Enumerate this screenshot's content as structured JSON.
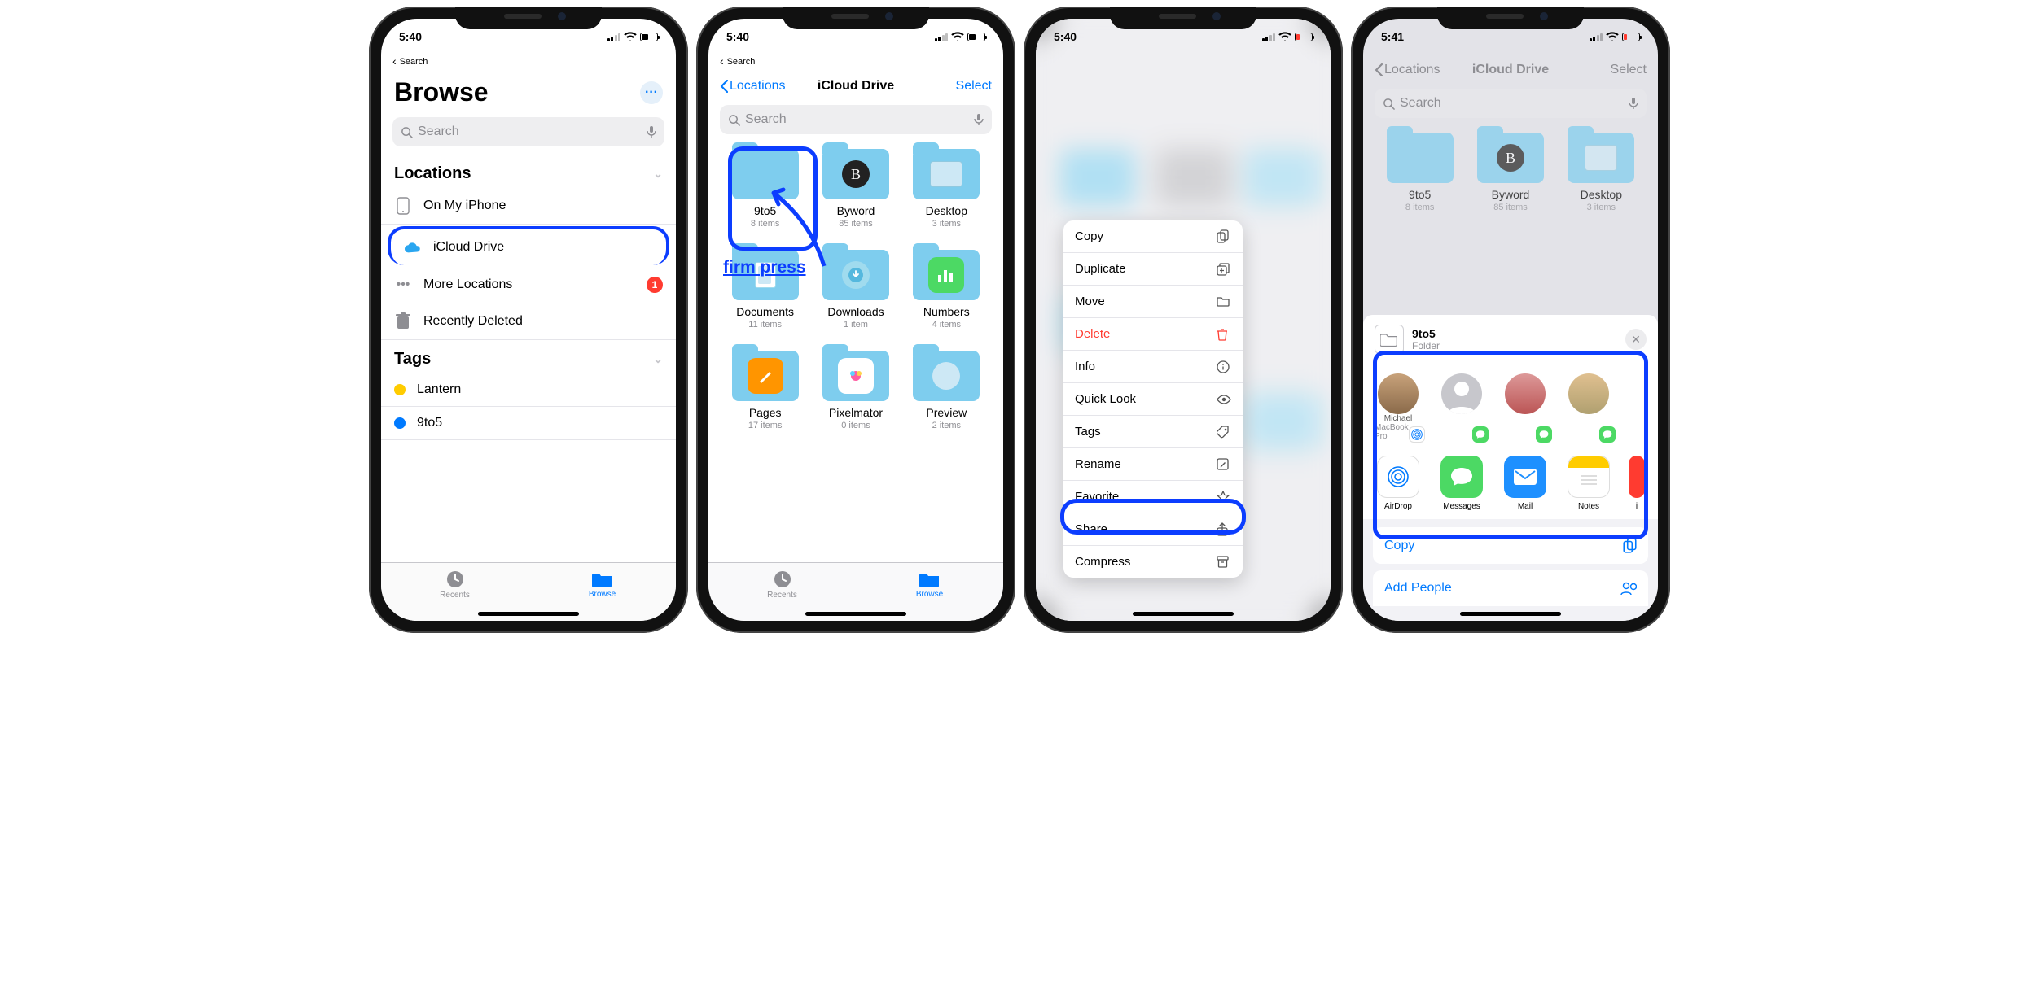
{
  "screens": {
    "s1": {
      "time": "5:40",
      "breadcrumb": "Search",
      "title": "Browse",
      "search_placeholder": "Search",
      "sections": {
        "locations": "Locations",
        "tags": "Tags"
      },
      "locations": [
        {
          "label": "On My iPhone"
        },
        {
          "label": "iCloud Drive"
        },
        {
          "label": "More Locations",
          "badge": "1"
        },
        {
          "label": "Recently Deleted"
        }
      ],
      "tags": [
        {
          "label": "Lantern",
          "color": "#ffcc00"
        },
        {
          "label": "9to5",
          "color": "#007aff"
        }
      ],
      "tabs": {
        "recents": "Recents",
        "browse": "Browse"
      }
    },
    "s2": {
      "time": "5:40",
      "breadcrumb": "Search",
      "back": "Locations",
      "title": "iCloud Drive",
      "select": "Select",
      "search_placeholder": "Search",
      "annotation": "firm press",
      "folders": [
        {
          "name": "9to5",
          "count": "8 items"
        },
        {
          "name": "Byword",
          "count": "85 items",
          "overlay": "B"
        },
        {
          "name": "Desktop",
          "count": "3 items"
        },
        {
          "name": "Documents",
          "count": "11 items"
        },
        {
          "name": "Downloads",
          "count": "1 item"
        },
        {
          "name": "Numbers",
          "count": "4 items"
        },
        {
          "name": "Pages",
          "count": "17 items"
        },
        {
          "name": "Pixelmator",
          "count": "0 items"
        },
        {
          "name": "Preview",
          "count": "2 items"
        }
      ],
      "tabs": {
        "recents": "Recents",
        "browse": "Browse"
      }
    },
    "s3": {
      "time": "5:40",
      "menu": [
        {
          "label": "Copy",
          "icon": "⎘"
        },
        {
          "label": "Duplicate",
          "icon": "⊞"
        },
        {
          "label": "Move",
          "icon": "📁"
        },
        {
          "label": "Delete",
          "icon": "🗑",
          "destructive": true
        },
        {
          "label": "Info",
          "icon": "ⓘ"
        },
        {
          "label": "Quick Look",
          "icon": "👁"
        },
        {
          "label": "Tags",
          "icon": "🏷"
        },
        {
          "label": "Rename",
          "icon": "✎"
        },
        {
          "label": "Favorite",
          "icon": "☆"
        },
        {
          "label": "Share",
          "icon": "⇪"
        },
        {
          "label": "Compress",
          "icon": "⊟"
        }
      ]
    },
    "s4": {
      "time": "5:41",
      "back": "Locations",
      "title": "iCloud Drive",
      "select": "Select",
      "search_placeholder": "Search",
      "folders": [
        {
          "name": "9to5",
          "count": "8 items"
        },
        {
          "name": "Byword",
          "count": "85 items"
        },
        {
          "name": "Desktop",
          "count": "3 items"
        }
      ],
      "sheet": {
        "item_name": "9to5",
        "item_type": "Folder",
        "contacts": [
          {
            "name": "Michael",
            "sub": "MacBook Pro"
          },
          {
            "name": ""
          },
          {
            "name": ""
          },
          {
            "name": ""
          }
        ],
        "apps": [
          {
            "name": "AirDrop"
          },
          {
            "name": "Messages"
          },
          {
            "name": "Mail"
          },
          {
            "name": "Notes"
          },
          {
            "name": "i"
          }
        ],
        "actions": [
          {
            "label": "Copy"
          },
          {
            "label": "Add People"
          }
        ]
      }
    }
  }
}
